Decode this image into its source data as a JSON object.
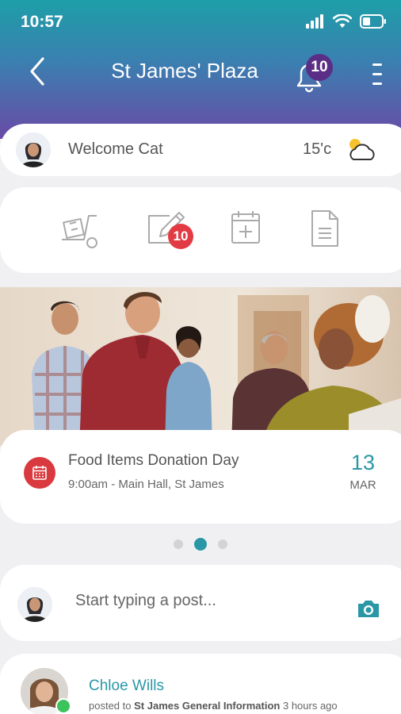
{
  "status_bar": {
    "time": "10:57"
  },
  "nav": {
    "title": "St James' Plaza",
    "notification_count": "10"
  },
  "welcome": {
    "greeting": "Welcome Cat",
    "temperature": "15'c",
    "weather_icon": "partly-cloudy-icon"
  },
  "actions": [
    {
      "icon": "delivery-trolley-icon"
    },
    {
      "icon": "edit-note-icon",
      "badge": "10"
    },
    {
      "icon": "add-calendar-icon"
    },
    {
      "icon": "document-icon"
    }
  ],
  "event": {
    "title": "Food Items Donation Day",
    "details": "9:00am - Main Hall, St James",
    "day": "13",
    "month": "MAR"
  },
  "carousel": {
    "count": 3,
    "active_index": 1
  },
  "composer": {
    "placeholder": "Start typing a post..."
  },
  "feed": {
    "author": "Chloe Wills",
    "posted_to_prefix": "posted to",
    "group": "St James General Information",
    "time_ago": "3 hours ago"
  },
  "colors": {
    "accent": "#2a97a6",
    "badge_red": "#e23b43",
    "badge_purple": "#5b2e86",
    "header_top": "#1d9fa8",
    "header_bottom": "#6a4aa6"
  }
}
